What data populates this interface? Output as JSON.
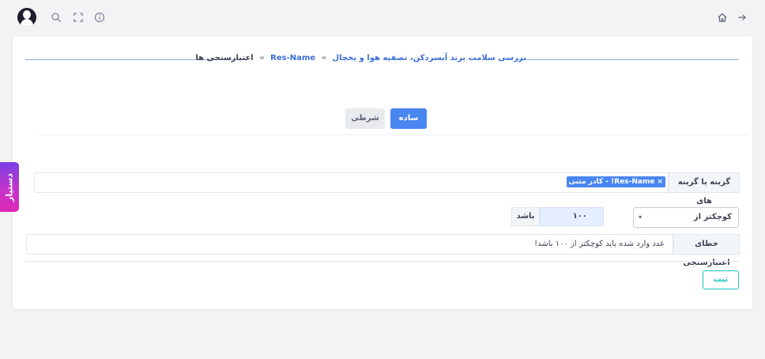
{
  "topbar": {
    "left_icons": [
      "user-avatar",
      "search-icon",
      "fullscreen-icon",
      "info-icon"
    ],
    "right_icons": [
      "home-icon",
      "arrow-right-icon"
    ]
  },
  "breadcrumb": {
    "items": [
      {
        "label": "بررسی سلامت برند آبسردکن، تصفیه هوا و یخچال",
        "link": true
      },
      {
        "label": "Res-Name",
        "link": true
      },
      {
        "label": "اعتبارسنجی ها",
        "link": false
      }
    ],
    "separator": "»"
  },
  "tabs": {
    "simple": "ساده",
    "conditional": "شرطی"
  },
  "options_row": {
    "label": "گزینه یا گزینه های",
    "selected_tag": "Res-Name! - کادر متنی",
    "tag_remove": "×"
  },
  "condition_row": {
    "operator": "کوچکتر از",
    "operator_caret": "▾",
    "value": "۱۰۰",
    "suffix": "باشد"
  },
  "error_row": {
    "label": "خطای اعتبارسنجی",
    "message": "عدد وارد شده باید کوچکتر از ۱۰۰ باشد!"
  },
  "submit_label": "ثبت",
  "assistant_label": "دستیار",
  "colors": {
    "primary": "#4a86f0",
    "success": "#1bc5bd",
    "assistant_gradient_start": "#7b3fe4",
    "assistant_gradient_end": "#e028b6"
  }
}
